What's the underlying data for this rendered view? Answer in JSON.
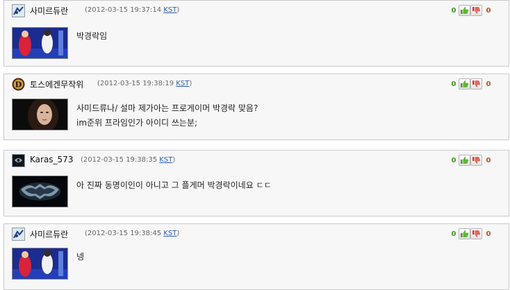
{
  "comments": [
    {
      "author": "사미르듀란",
      "timestamp": "(2012-03-15 19:37:14",
      "timezone": "KST",
      "close": ")",
      "up_votes": "0",
      "down_votes": "0",
      "lines": [
        "박경락임"
      ]
    },
    {
      "author": "토스에겐무작위",
      "timestamp": "(2012-03-15 19:38:19",
      "timezone": "KST",
      "close": ")",
      "up_votes": "0",
      "down_votes": "0",
      "lines": [
        "사미드류나/ 설마 제가아는 프로게이머 박경락 맞음?",
        "im준위 프라임인가 아이디 쓰는분;"
      ]
    },
    {
      "author": "Karas_573",
      "timestamp": "(2012-03-15 19:38:35",
      "timezone": "KST",
      "close": ")",
      "up_votes": "0",
      "down_votes": "0",
      "lines": [
        "아 진짜 동명이인이 아니고 그 플게머 박경락이네요 ㄷㄷ"
      ]
    },
    {
      "author": "사미르듀란",
      "timestamp": "(2012-03-15 19:38:45",
      "timezone": "KST",
      "close": ")",
      "up_votes": "0",
      "down_votes": "0",
      "lines": [
        "넹"
      ]
    }
  ],
  "icons": {
    "thumb_up": "thumbs-up-icon",
    "thumb_down": "thumbs-down-icon"
  },
  "colors": {
    "up_count": "#3b9a1e",
    "down_count": "#d04a14",
    "timezone_link": "#2a5db0",
    "comment_background": "#f7f7f7",
    "comment_border": "#c9c9c9"
  }
}
